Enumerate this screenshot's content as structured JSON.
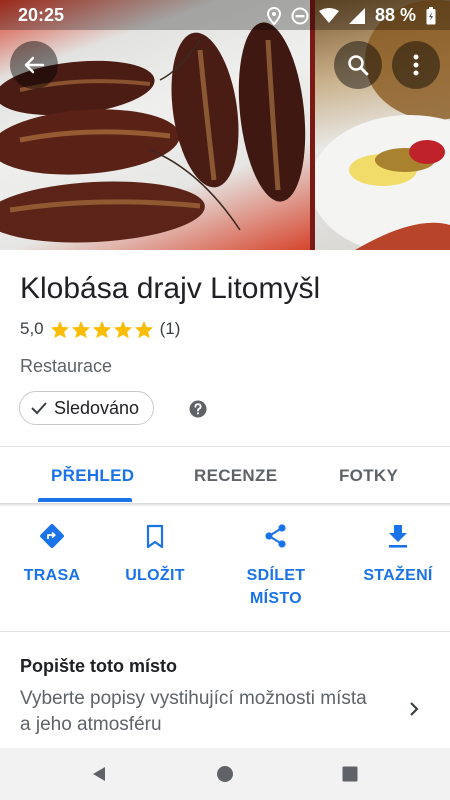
{
  "status_bar": {
    "time": "20:25",
    "battery": "88 %",
    "icons": [
      "location-icon",
      "dnd-icon",
      "wifi-icon",
      "signal-icon",
      "battery-icon"
    ]
  },
  "header": {
    "back_icon": "arrow-back-icon",
    "search_icon": "search-icon",
    "more_icon": "more-vert-icon"
  },
  "place": {
    "name": "Klobása drajv Litomyšl",
    "rating": "5,0",
    "stars": 5,
    "review_count": "(1)",
    "category": "Restaurace",
    "follow_label": "Sledováno"
  },
  "tabs": [
    {
      "label": "PŘEHLED",
      "active": true
    },
    {
      "label": "RECENZE",
      "active": false
    },
    {
      "label": "FOTKY",
      "active": false
    }
  ],
  "actions": [
    {
      "label": "TRASA",
      "icon": "directions-icon"
    },
    {
      "label": "ULOŽIT",
      "icon": "bookmark-icon"
    },
    {
      "label": "SDÍLET\nMÍSTO",
      "line1": "SDÍLET",
      "line2": "MÍSTO",
      "icon": "share-icon"
    },
    {
      "label": "STAŽENÍ",
      "icon": "download-icon"
    }
  ],
  "describe": {
    "title": "Popište toto místo",
    "subtitle": "Vyberte popisy vystihující možnosti místa a jeho atmosféru"
  },
  "colors": {
    "accent": "#1a73e8",
    "star": "#fbbc04",
    "text_secondary": "#5f6368"
  }
}
